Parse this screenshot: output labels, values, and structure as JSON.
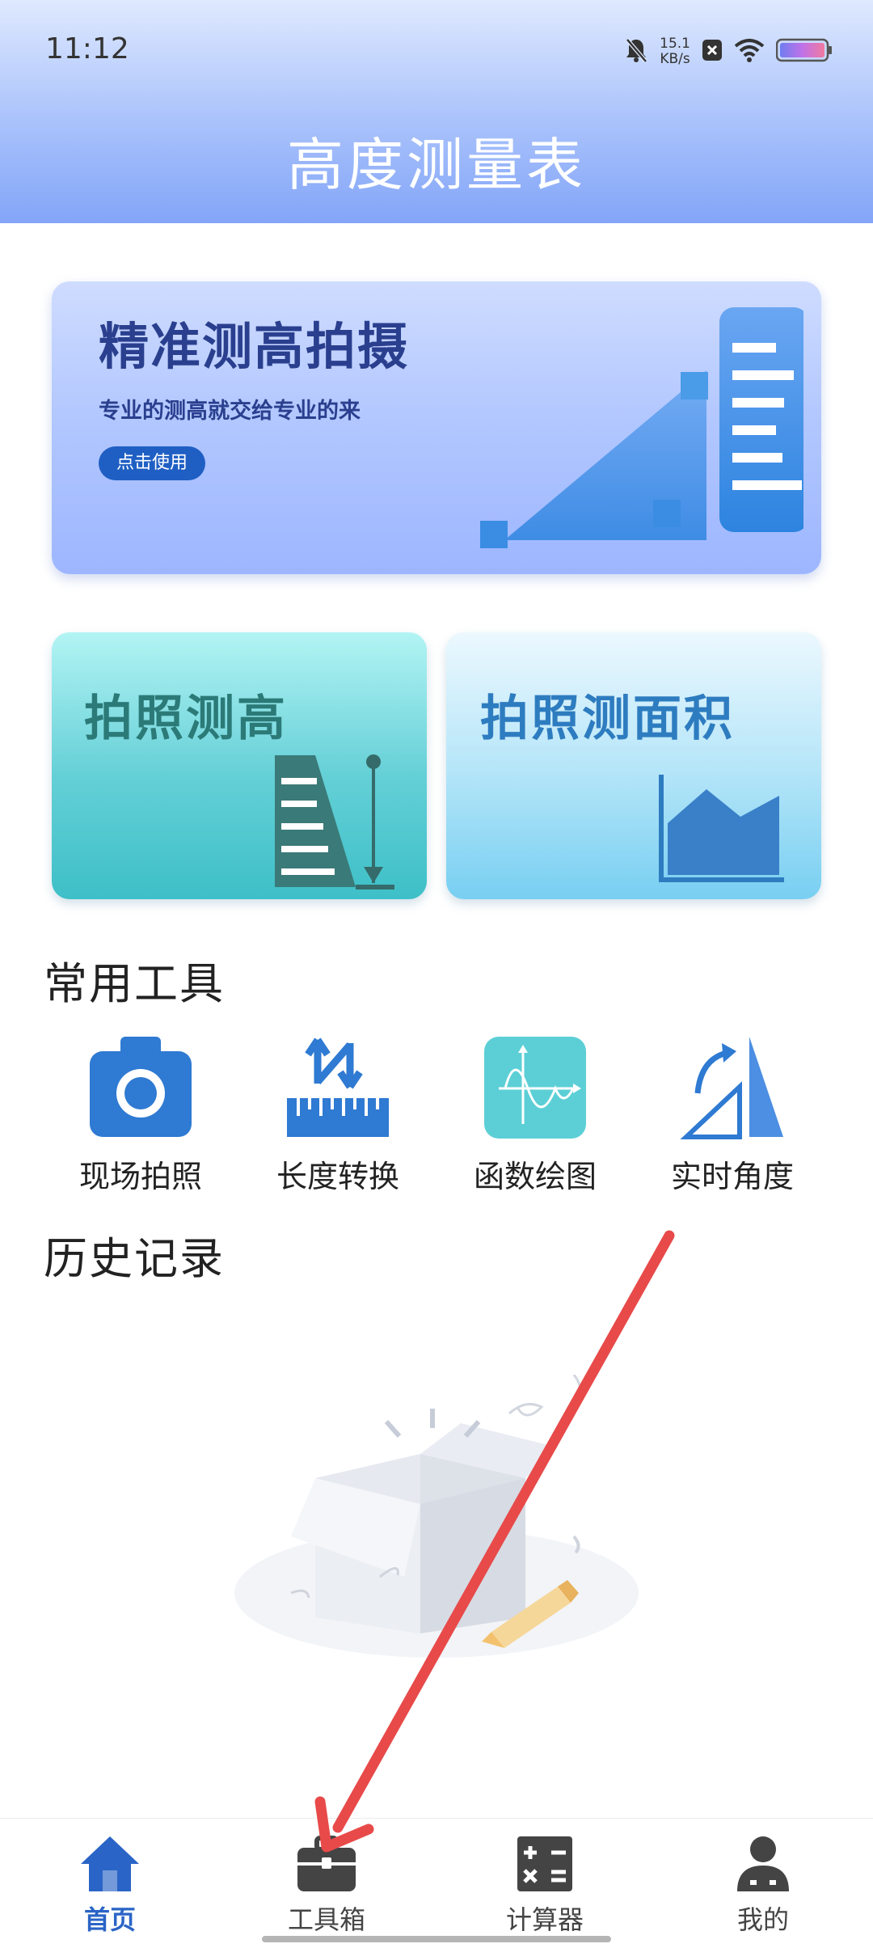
{
  "status_bar": {
    "time": "11:12",
    "net_speed_value": "15.1",
    "net_speed_unit": "KB/s",
    "icons": [
      "bell-muted-icon",
      "close-badge-icon",
      "wifi-icon",
      "battery-icon"
    ]
  },
  "header": {
    "title": "高度测量表"
  },
  "banner": {
    "title": "精准测高拍摄",
    "subtitle": "专业的测高就交给专业的来",
    "button_label": "点击使用"
  },
  "cards": [
    {
      "title": "拍照测高",
      "icon": "height-ruler-icon"
    },
    {
      "title": "拍照测面积",
      "icon": "area-chart-icon"
    }
  ],
  "tools_section": {
    "title": "常用工具",
    "items": [
      {
        "label": "现场拍照",
        "icon": "camera-icon"
      },
      {
        "label": "长度转换",
        "icon": "ruler-convert-icon"
      },
      {
        "label": "函数绘图",
        "icon": "function-graph-icon"
      },
      {
        "label": "实时角度",
        "icon": "angle-icon"
      }
    ]
  },
  "history_section": {
    "title": "历史记录",
    "empty_icon": "empty-box-icon"
  },
  "tabbar": {
    "items": [
      {
        "label": "首页",
        "icon": "home-icon",
        "active": true
      },
      {
        "label": "工具箱",
        "icon": "toolbox-icon",
        "active": false
      },
      {
        "label": "计算器",
        "icon": "calculator-icon",
        "active": false
      },
      {
        "label": "我的",
        "icon": "user-icon",
        "active": false
      }
    ]
  },
  "colors": {
    "accent": "#2a64c6",
    "banner_text": "#2a3f8e",
    "annotation_arrow": "#e84a4a"
  }
}
